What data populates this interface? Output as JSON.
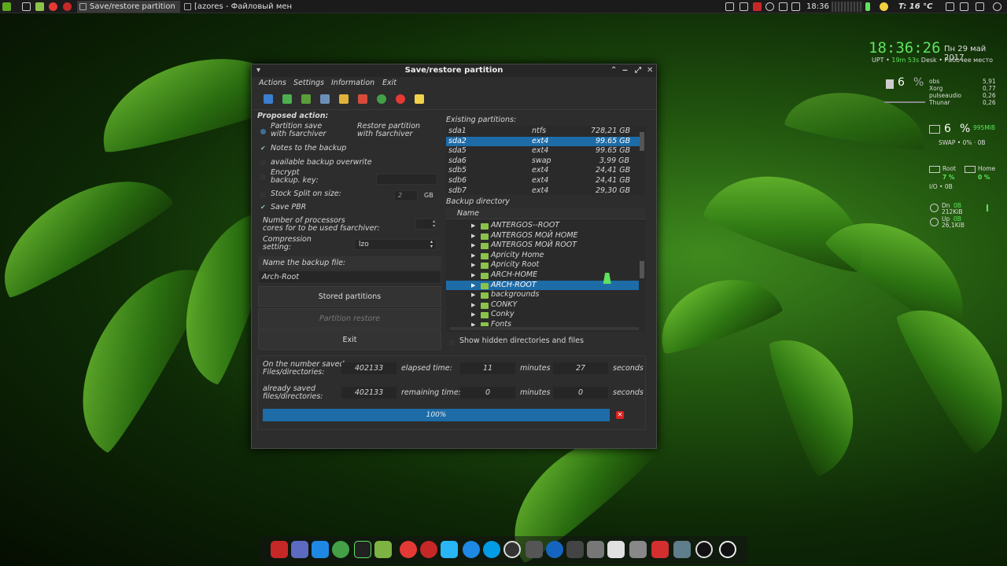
{
  "taskbar": {
    "tasks": [
      {
        "label": "Save/restore partition",
        "active": true
      },
      {
        "label": "[azores - Файловый мен...",
        "active": false
      }
    ],
    "time": "18:36",
    "weather": "T: 16 °C"
  },
  "conky": {
    "clock": "18:36:26",
    "date": "Пн 29 май 2017",
    "uptime_label": "UPT •",
    "uptime_value": "19m 53s",
    "uptime_rest": "Desk • Рабочее место",
    "cpu_percent": "6",
    "cpu_unit": "%",
    "processes": [
      {
        "name": "obs",
        "value": "5,91"
      },
      {
        "name": "Xorg",
        "value": "0,77"
      },
      {
        "name": "pulseaudio",
        "value": "0,26"
      },
      {
        "name": "Thunar",
        "value": "0,26"
      }
    ],
    "mem_percent": "6",
    "mem_unit": "%",
    "mem_value": "995MiB",
    "swap": "SWAP • 0% · 0B",
    "root_label": "Root",
    "root_pct": "7 %",
    "home_label": "Home",
    "home_pct": "0 %",
    "io": "I/O • 0B",
    "down_label": "Dn",
    "down_total": "0B",
    "down_rate": "212KiB",
    "up_label": "Up",
    "up_total": "0B",
    "up_rate": "26,1KiB"
  },
  "window": {
    "title": "Save/restore partition",
    "menu": [
      "Actions",
      "Settings",
      "Information",
      "Exit"
    ],
    "proposed_action": "Proposed action:",
    "radio_save": "Partition save\nwith fsarchiver",
    "radio_restore": "Restore partition\nwith fsarchiver",
    "notes": "Notes to  the backup",
    "overwrite": "available backup overwrite",
    "encrypt": "Encrypt\nbackup. key:",
    "split_label": "Stock Split on size:",
    "split_value": "2",
    "split_unit": "GB",
    "save_pbr": "Save PBR",
    "processors_label": "Number of processors\ncores for to be used fsarchiver:",
    "compression_label": "Compression\nsetting:",
    "compression_value": "lzo",
    "backup_name_label": "Name the backup file:",
    "backup_name_value": "Arch-Root",
    "stored_btn": "Stored partitions",
    "restore_btn": "Partition restore",
    "exit_btn": "Exit",
    "existing_label": "Existing partitions:",
    "partitions": [
      {
        "dev": "sda1",
        "fs": "ntfs",
        "size": "728,21 GB"
      },
      {
        "dev": "sda2",
        "fs": "ext4",
        "size": "99.65 GB",
        "selected": true
      },
      {
        "dev": "sda5",
        "fs": "ext4",
        "size": "99.65 GB"
      },
      {
        "dev": "sda6",
        "fs": "swap",
        "size": "3,99 GB"
      },
      {
        "dev": "sdb5",
        "fs": "ext4",
        "size": "24,41 GB"
      },
      {
        "dev": "sdb6",
        "fs": "ext4",
        "size": "24,41 GB"
      },
      {
        "dev": "sdb7",
        "fs": "ext4",
        "size": "29,30 GB"
      }
    ],
    "backup_dir_label": "Backup directory",
    "name_col": "Name",
    "dirs": [
      {
        "name": "ANTERGOS--ROOT"
      },
      {
        "name": "ANTERGOS МОЙ HOME"
      },
      {
        "name": "ANTERGOS МОЙ ROOT"
      },
      {
        "name": "Apricity Home"
      },
      {
        "name": "Apricity Root"
      },
      {
        "name": "ARCH-HOME"
      },
      {
        "name": "ARCH-ROOT",
        "selected": true
      },
      {
        "name": "backgrounds"
      },
      {
        "name": "CONKY"
      },
      {
        "name": "Conky"
      },
      {
        "name": "Fonts"
      }
    ],
    "show_hidden": "Show hidden directories and files",
    "saved_label": "On the number saved\nFiles/directories:",
    "saved_value": "402133",
    "elapsed_label": "elapsed time:",
    "elapsed_min": "11",
    "minutes": "minutes",
    "elapsed_sec": "27",
    "seconds": "seconds",
    "already_label": "already saved\nfiles/directories:",
    "already_value": "402133",
    "remaining_label": "remaining time:",
    "remaining_min": "0",
    "remaining_sec": "0",
    "progress_text": "100%",
    "progress_value": 1.0
  },
  "colors": {
    "accent": "#1d6ca8",
    "conky_green": "#5ee35e"
  }
}
